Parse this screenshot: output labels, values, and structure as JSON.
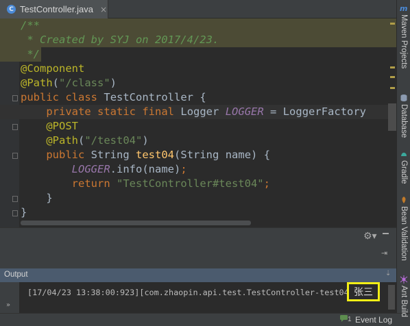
{
  "tab": {
    "icon_letter": "C",
    "title": "TestController.java",
    "close": "×"
  },
  "code_lines": [
    "/**",
    " * Created by SYJ on 2017/4/23.",
    " */",
    "@Component",
    "@Path(\"/class\")",
    "public class TestController {",
    "    private static final Logger LOGGER = LoggerFactory",
    "    @POST",
    "    @Path(\"/test04\")",
    "    public String test04(String name) {",
    "        LOGGER.info(name);",
    "        return \"TestController#test04\";",
    "    }",
    "}"
  ],
  "output": {
    "title": "Output",
    "log_text": "[17/04/23 13:38:00:923][com.zhaopin.api.test.TestController-test04]",
    "highlighted_value": "张三",
    "expand_icon": "»"
  },
  "status": {
    "event_count": "1",
    "event_log_label": "Event Log"
  },
  "tool_windows": [
    {
      "label": "Maven Projects",
      "icon": "maven-icon"
    },
    {
      "label": "Database",
      "icon": "database-icon"
    },
    {
      "label": "Gradle",
      "icon": "gradle-icon"
    },
    {
      "label": "Bean Validation",
      "icon": "bean-validation-icon"
    },
    {
      "label": "Ant Build",
      "icon": "ant-build-icon"
    }
  ],
  "colors": {
    "editor_bg": "#2b2b2b",
    "keyword": "#cc7832",
    "annotation": "#bbb529",
    "string": "#6a8759",
    "function": "#ffc66d",
    "constant": "#9876aa",
    "doc_comment": "#629755",
    "highlight_border": "#f2ee16"
  }
}
